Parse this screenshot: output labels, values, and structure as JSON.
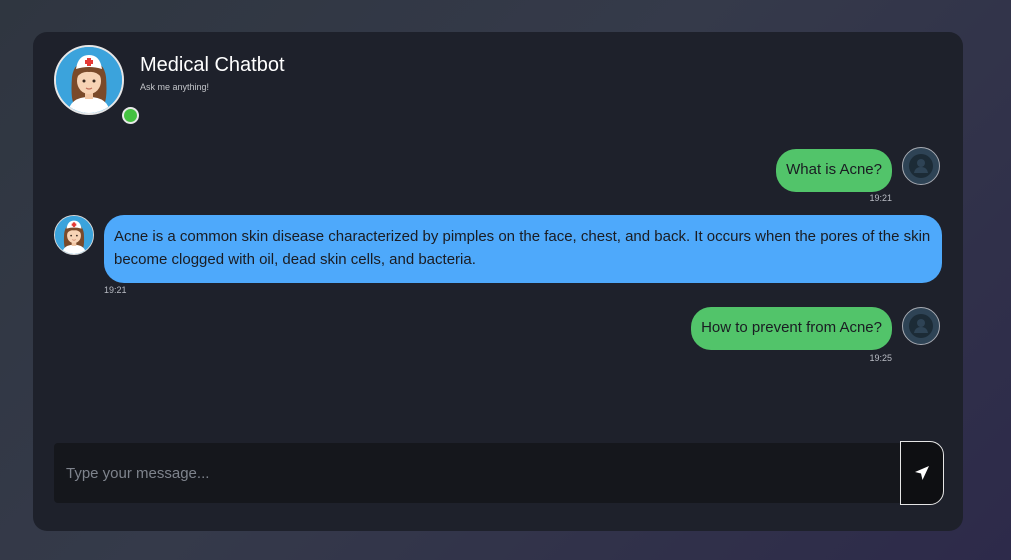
{
  "header": {
    "title": "Medical Chatbot",
    "subtitle": "Ask me anything!",
    "status": "online"
  },
  "messages": [
    {
      "sender": "user",
      "text": "What is Acne?",
      "time": "19:21"
    },
    {
      "sender": "bot",
      "text": "Acne is a common skin disease characterized by pimples on the face, chest, and back. It occurs when the pores of the skin become clogged with oil, dead skin cells, and bacteria.",
      "time": "19:21"
    },
    {
      "sender": "user",
      "text": "How to prevent from Acne?",
      "time": "19:25"
    }
  ],
  "composer": {
    "placeholder": "Type your message...",
    "send_icon": "send-arrow-icon"
  },
  "colors": {
    "user_bubble": "#52c46a",
    "bot_bubble": "#4ea9fb",
    "card_bg": "#1e212b",
    "online": "#44c140"
  }
}
